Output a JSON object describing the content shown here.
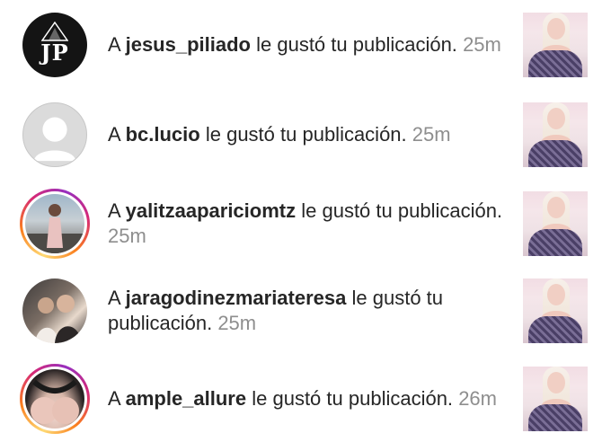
{
  "notifications": [
    {
      "prefix": "A",
      "username": "jesus_piliado",
      "action": "le gustó tu publicación.",
      "time": "25m",
      "avatar": {
        "type": "logo",
        "initials": "JP",
        "story_ring": false
      }
    },
    {
      "prefix": "A",
      "username": "bc.lucio",
      "action": "le gustó tu publicación.",
      "time": "25m",
      "avatar": {
        "type": "default",
        "story_ring": false
      }
    },
    {
      "prefix": "A",
      "username": "yalitzaapariciomtz",
      "action": "le gustó tu publicación.",
      "time": "25m",
      "avatar": {
        "type": "photo",
        "story_ring": true
      }
    },
    {
      "prefix": "A",
      "username": "jaragodinezmariateresa",
      "action": "le gustó tu publicación.",
      "time": "25m",
      "avatar": {
        "type": "photo",
        "story_ring": false
      }
    },
    {
      "prefix": "A",
      "username": "ample_allure",
      "action": "le gustó tu publicación.",
      "time": "26m",
      "avatar": {
        "type": "photo",
        "story_ring": true
      }
    }
  ],
  "colors": {
    "text": "#262626",
    "timestamp": "#8e8e8e",
    "story_ring": [
      "#feda75",
      "#fa7e1e",
      "#d62976",
      "#962fbf"
    ]
  }
}
